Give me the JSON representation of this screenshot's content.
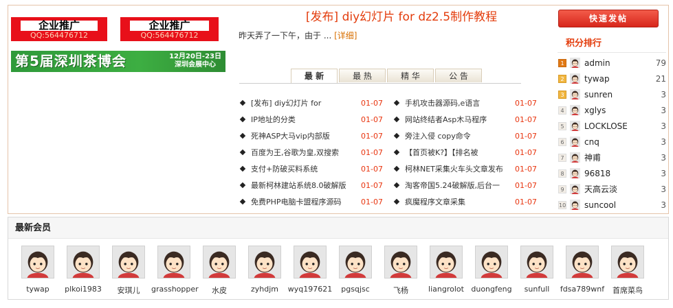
{
  "ads": {
    "ad1_text": "企业推广",
    "ad1_qq": "QQ:564476712",
    "ad2_text": "企业推广",
    "ad2_qq": "QQ:564476712",
    "expo_title": "第5届深圳茶博会",
    "expo_date_line1": "12月20日-23日",
    "expo_date_line2": "深圳会展中心"
  },
  "headline": {
    "title": "[发布] diy幻灯片 for dz2.5制作教程",
    "summary": "昨天弄了一下午，由于 ...",
    "detail_link": "[详细]"
  },
  "tabs": [
    "最 新",
    "最 热",
    "精 华",
    "公 告"
  ],
  "list_left": [
    {
      "text": "[发布] diy幻灯片 for",
      "date": "01-07"
    },
    {
      "text": "IP地址的分类",
      "date": "01-07"
    },
    {
      "text": "死神ASP大马vip内部版",
      "date": "01-07"
    },
    {
      "text": "百度为王,谷歌为皇,双搜索",
      "date": "01-07"
    },
    {
      "text": "支付+防破买料系统",
      "date": "01-07"
    },
    {
      "text": "最新柯林建站系统8.0破解版",
      "date": "01-07"
    },
    {
      "text": "免费PHP电脑卡盟程序源码",
      "date": "01-07"
    }
  ],
  "list_right": [
    {
      "text": "手机攻击器源码,e语言",
      "date": "01-07"
    },
    {
      "text": "网站终结者Asp木马程序",
      "date": "01-07"
    },
    {
      "text": "旁注入侵 copy命令",
      "date": "01-07"
    },
    {
      "text": "【首页被K?】【排名被",
      "date": "01-07"
    },
    {
      "text": "柯林NET采集火车头文章发布",
      "date": "01-07"
    },
    {
      "text": "淘客帝国5.24破解版,后台一",
      "date": "01-07"
    },
    {
      "text": "疯魔程序文章采集",
      "date": "01-07"
    }
  ],
  "post_button": "快速发帖",
  "ranking_title": "积分排行",
  "ranking": [
    {
      "rank": "1",
      "name": "admin",
      "score": "79"
    },
    {
      "rank": "2",
      "name": "tywap",
      "score": "21"
    },
    {
      "rank": "3",
      "name": "sunren",
      "score": "3"
    },
    {
      "rank": "4",
      "name": "xglys",
      "score": "3"
    },
    {
      "rank": "5",
      "name": "LOCKLOSE",
      "score": "3"
    },
    {
      "rank": "6",
      "name": "cnq",
      "score": "3"
    },
    {
      "rank": "7",
      "name": "神甫",
      "score": "3"
    },
    {
      "rank": "8",
      "name": "96818",
      "score": "3"
    },
    {
      "rank": "9",
      "name": "天高云淡",
      "score": "3"
    },
    {
      "rank": "10",
      "name": "suncool",
      "score": "3"
    }
  ],
  "members_title": "最新会员",
  "members": [
    "tywap",
    "plkoi1983",
    "安琪儿",
    "grasshopper",
    "水皮",
    "zyhdjm",
    "wyq197621",
    "pgsqjsc",
    "飞杨",
    "liangrolot",
    "duongfeng",
    "sunfull",
    "fdsa789wnf",
    "首席菜鸟"
  ],
  "colors": {
    "accent": "#e33c0c",
    "date": "#e8340e",
    "ad_red": "#e8101a",
    "expo_green": "#3dae42"
  }
}
